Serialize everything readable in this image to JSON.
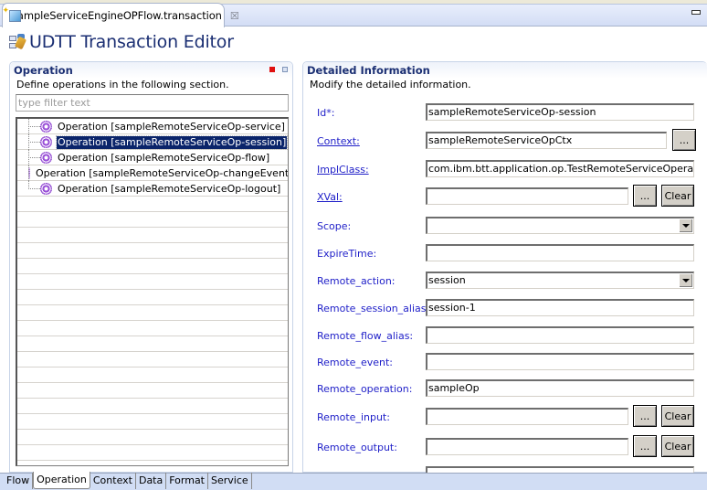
{
  "editor_tab": {
    "title": "sampleServiceEngineOPFlow.transaction",
    "close_glyph": "☒"
  },
  "editor": {
    "title": "UDTT Transaction Editor"
  },
  "operation_section": {
    "title": "Operation",
    "description": "Define operations in the following section.",
    "filter_placeholder": "type filter text",
    "items": [
      {
        "label": "Operation [sampleRemoteServiceOp-service]",
        "selected": false
      },
      {
        "label": "Operation [sampleRemoteServiceOp-session]",
        "selected": true
      },
      {
        "label": "Operation [sampleRemoteServiceOp-flow]",
        "selected": false
      },
      {
        "label": "Operation [sampleRemoteServiceOp-changeEvent]",
        "selected": false
      },
      {
        "label": "Operation [sampleRemoteServiceOp-logout]",
        "selected": false
      }
    ]
  },
  "details_section": {
    "title": "Detailed Information",
    "description": "Modify the detailed information.",
    "fields": {
      "id": {
        "label": "Id*:",
        "value": "sampleRemoteServiceOp-session"
      },
      "context": {
        "label": "Context:",
        "value": "sampleRemoteServiceOpCtx"
      },
      "implclass": {
        "label": "ImplClass:",
        "value": "com.ibm.btt.application.op.TestRemoteServiceOperation"
      },
      "xval": {
        "label": "XVal:",
        "value": ""
      },
      "scope": {
        "label": "Scope:",
        "value": ""
      },
      "expiretime": {
        "label": "ExpireTime:",
        "value": ""
      },
      "remote_action": {
        "label": "Remote_action:",
        "value": "session"
      },
      "remote_session_alias": {
        "label": "Remote_session_alias:",
        "value": "session-1"
      },
      "remote_flow_alias": {
        "label": "Remote_flow_alias:",
        "value": ""
      },
      "remote_event": {
        "label": "Remote_event:",
        "value": ""
      },
      "remote_operation": {
        "label": "Remote_operation:",
        "value": "sampleOp"
      },
      "remote_input": {
        "label": "Remote_input:",
        "value": ""
      },
      "remote_output": {
        "label": "Remote_output:",
        "value": ""
      }
    },
    "browse_label": "...",
    "clear_label": "Clear"
  },
  "bottom_tabs": [
    {
      "label": "Flow",
      "active": false
    },
    {
      "label": "Operation",
      "active": true
    },
    {
      "label": "Context",
      "active": false
    },
    {
      "label": "Data",
      "active": false
    },
    {
      "label": "Format",
      "active": false
    },
    {
      "label": "Service",
      "active": false
    }
  ]
}
